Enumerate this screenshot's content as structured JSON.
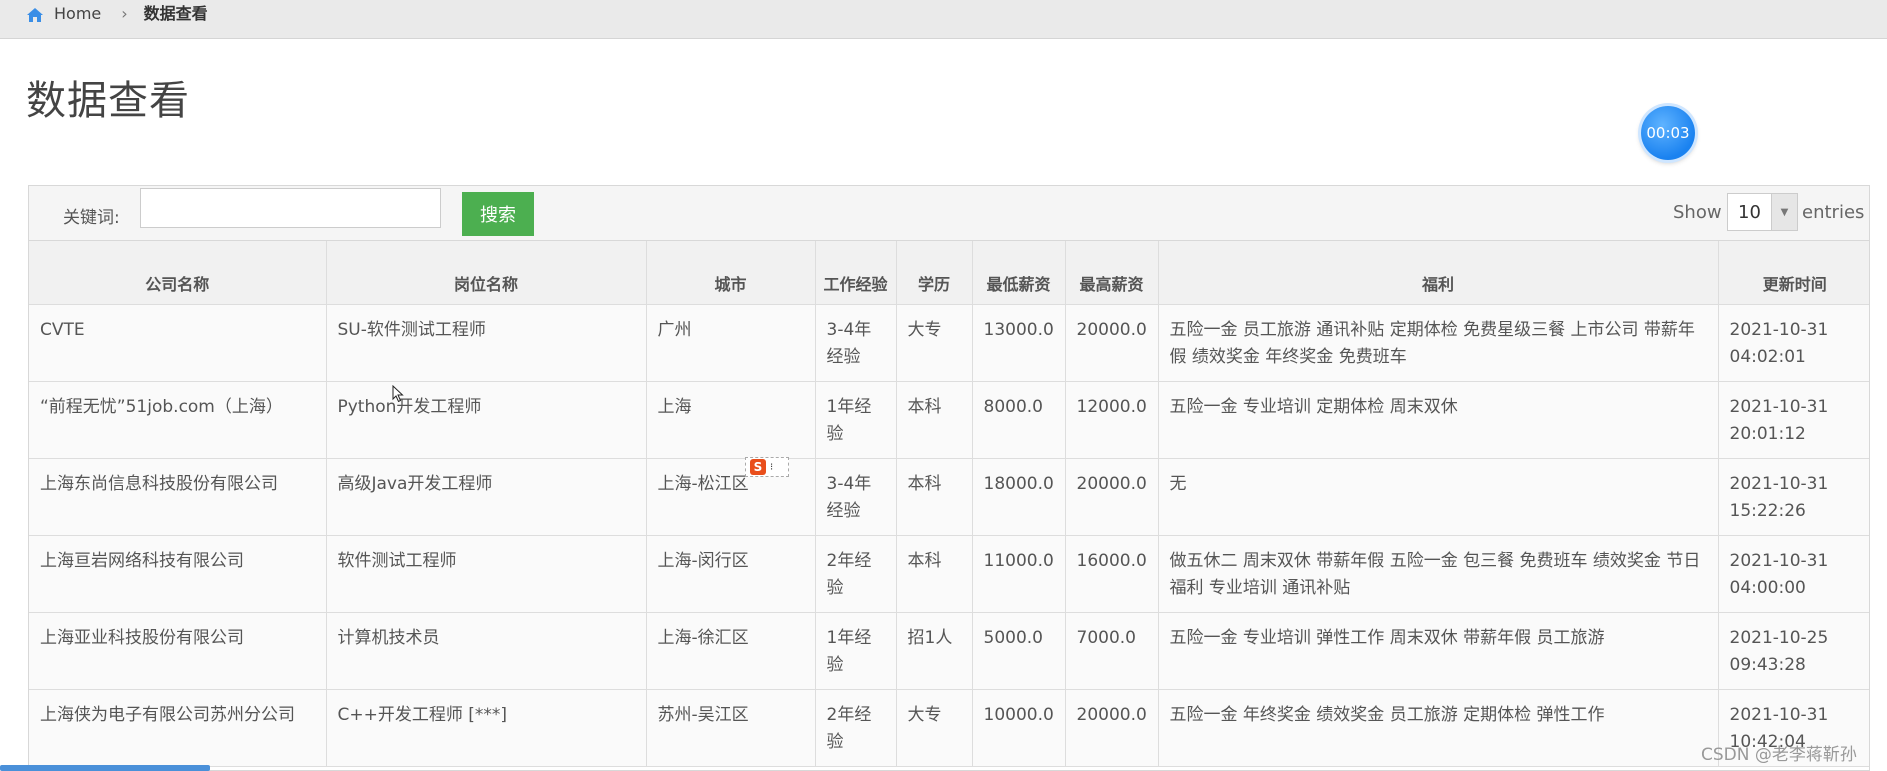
{
  "breadcrumb": {
    "home": "Home",
    "separator": "›",
    "current": "数据查看"
  },
  "page_title": "数据查看",
  "timer": "00:03",
  "toolbar": {
    "keyword_label": "关键词:",
    "keyword_value": "",
    "search_label": "搜索",
    "show_label": "Show",
    "entries_value": "10",
    "entries_label": "entries"
  },
  "table": {
    "headers": [
      "公司名称",
      "岗位名称",
      "城市",
      "工作经验",
      "学历",
      "最低薪资",
      "最高薪资",
      "福利",
      "更新时间"
    ],
    "rows": [
      [
        "CVTE",
        "SU-软件测试工程师",
        "广州",
        "3-4年经验",
        "大专",
        "13000.0",
        "20000.0",
        "五险一金 员工旅游 通讯补贴 定期体检 免费星级三餐 上市公司 带薪年假 绩效奖金 年终奖金 免费班车",
        "2021-10-31 04:02:01"
      ],
      [
        "“前程无忧”51job.com（上海）",
        "Python开发工程师",
        "上海",
        "1年经验",
        "本科",
        "8000.0",
        "12000.0",
        "五险一金 专业培训 定期体检 周末双休",
        "2021-10-31 20:01:12"
      ],
      [
        "上海东尚信息科技股份有限公司",
        "高级Java开发工程师",
        "上海-松江区",
        "3-4年经验",
        "本科",
        "18000.0",
        "20000.0",
        "无",
        "2021-10-31 15:22:26"
      ],
      [
        "上海亘岩网络科技有限公司",
        "软件测试工程师",
        "上海-闵行区",
        "2年经验",
        "本科",
        "11000.0",
        "16000.0",
        "做五休二 周末双休 带薪年假 五险一金 包三餐 免费班车 绩效奖金 节日福利 专业培训 通讯补贴",
        "2021-10-31 04:00:00"
      ],
      [
        "上海亚业科技股份有限公司",
        "计算机技术员",
        "上海-徐汇区",
        "1年经验",
        "招1人",
        "5000.0",
        "7000.0",
        "五险一金 专业培训 弹性工作 周末双休 带薪年假 员工旅游",
        "2021-10-25 09:43:28"
      ],
      [
        "上海侠为电子有限公司苏州分公司",
        "C++开发工程师 [***]",
        "苏州-吴江区",
        "2年经验",
        "大专",
        "10000.0",
        "20000.0",
        "五险一金 年终奖金 绩效奖金 员工旅游 定期体检 弹性工作",
        "2021-10-31 10:42:04"
      ]
    ]
  },
  "watermark": "CSDN @老李蒋靳孙",
  "colors": {
    "search_button": "#4caf50",
    "timer": "#1a82f0",
    "home_icon": "#3a8ee6"
  }
}
